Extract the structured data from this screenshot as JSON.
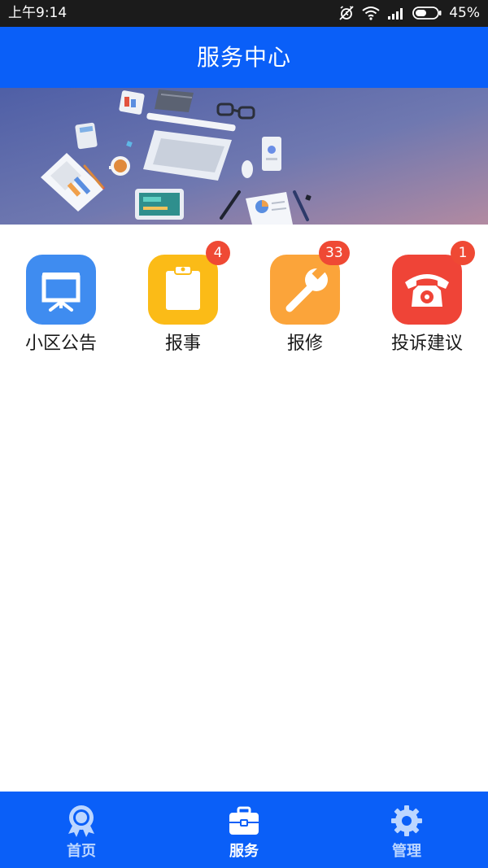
{
  "status_bar": {
    "time": "上午9:14",
    "battery_percent": "45%",
    "icons": [
      "alarm-off-icon",
      "wifi-icon",
      "signal-icon",
      "battery-icon"
    ]
  },
  "header": {
    "title": "服务中心"
  },
  "banner": {
    "description_icon": "workspace-illustration"
  },
  "services": [
    {
      "label": "小区公告",
      "icon": "presentation-board-icon",
      "color": "#3f8cf0",
      "badge": ""
    },
    {
      "label": "报事",
      "icon": "clipboard-icon",
      "color": "#fbbb17",
      "badge": "4"
    },
    {
      "label": "报修",
      "icon": "wrench-icon",
      "color": "#fba43a",
      "badge": "33"
    },
    {
      "label": "投诉建议",
      "icon": "telephone-icon",
      "color": "#ef4437",
      "badge": "1"
    }
  ],
  "bottom_nav": {
    "items": [
      {
        "label": "首页",
        "icon": "medal-icon",
        "active": false
      },
      {
        "label": "服务",
        "icon": "briefcase-icon",
        "active": true
      },
      {
        "label": "管理",
        "icon": "gear-icon",
        "active": false
      }
    ],
    "active_color": "#ffffff",
    "inactive_color": "#bcd6ff"
  },
  "colors": {
    "primary": "#0a5ff8",
    "badge": "#ef4934",
    "status_bar": "#1b1b1b"
  }
}
